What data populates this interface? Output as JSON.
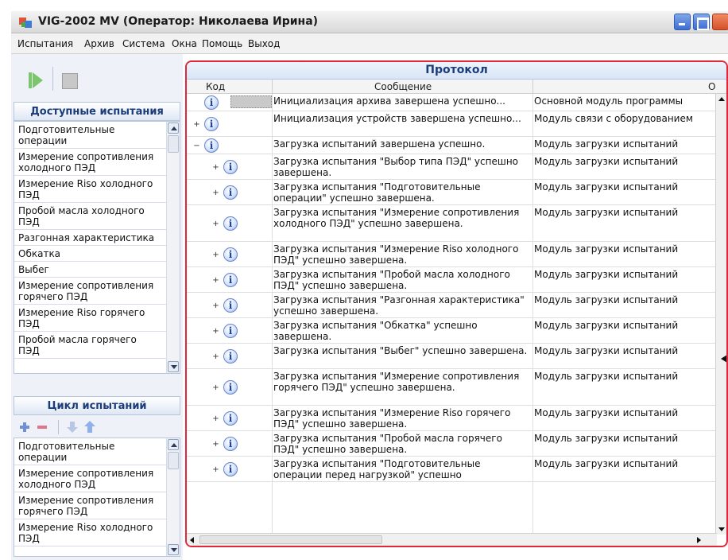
{
  "window": {
    "title": "VIG-2002 MV (Оператор: Николаева Ирина)"
  },
  "menu": [
    "Испытания",
    "Архив",
    "Система",
    "Окна",
    "Помощь",
    "Выход"
  ],
  "available_tests": {
    "title": "Доступные испытания",
    "items": [
      "Подготовительные операции",
      "Измерение сопротивления холодного ПЭД",
      "Измерение Riso холодного ПЭД",
      "Пробой масла холодного ПЭД",
      "Разгонная характеристика",
      "Обкатка",
      "Выбег",
      "Измерение сопротивления горячего ПЭД",
      "Измерение Riso горячего ПЭД",
      "Пробой масла горячего ПЭД"
    ]
  },
  "test_cycle": {
    "title": "Цикл испытаний",
    "items": [
      "Подготовительные операции",
      "Измерение сопротивления холодного ПЭД",
      "Измерение сопротивления горячего ПЭД",
      "Измерение Riso холодного ПЭД"
    ]
  },
  "protocol": {
    "title": "Протокол",
    "columns": {
      "code": "Код",
      "message": "Сообщение",
      "source": "О"
    },
    "info_glyph": "i",
    "rows": [
      {
        "level": 0,
        "expander": "",
        "message": "Инициализация архива завершена успешно...",
        "source": "Основной модуль программы"
      },
      {
        "level": 0,
        "expander": "+",
        "message": "Инициализация устройств завершена успешно...",
        "source": "Модуль связи с оборудованием"
      },
      {
        "level": 0,
        "expander": "−",
        "message": "Загрузка испытаний завершена успешно.",
        "source": "Модуль загрузки испытаний"
      },
      {
        "level": 1,
        "expander": "+",
        "message": "Загрузка испытания \"Выбор типа ПЭД\" успешно завершена.",
        "source": "Модуль загрузки испытаний"
      },
      {
        "level": 1,
        "expander": "+",
        "message": "Загрузка испытания \"Подготовительные операции\" успешно завершена.",
        "source": "Модуль загрузки испытаний"
      },
      {
        "level": 1,
        "expander": "+",
        "message": "Загрузка испытания \"Измерение сопротивления холодного ПЭД\" успешно завершена.",
        "source": "Модуль загрузки испытаний"
      },
      {
        "level": 1,
        "expander": "+",
        "message": "Загрузка испытания \"Измерение Riso холодного ПЭД\" успешно завершена.",
        "source": "Модуль загрузки испытаний"
      },
      {
        "level": 1,
        "expander": "+",
        "message": "Загрузка испытания \"Пробой масла холодного ПЭД\" успешно завершена.",
        "source": "Модуль загрузки испытаний"
      },
      {
        "level": 1,
        "expander": "+",
        "message": "Загрузка испытания \"Разгонная характеристика\" успешно завершена.",
        "source": "Модуль загрузки испытаний"
      },
      {
        "level": 1,
        "expander": "+",
        "message": "Загрузка испытания \"Обкатка\" успешно завершена.",
        "source": "Модуль загрузки испытаний"
      },
      {
        "level": 1,
        "expander": "+",
        "message": "Загрузка испытания \"Выбег\" успешно завершена.",
        "source": "Модуль загрузки испытаний"
      },
      {
        "level": 1,
        "expander": "+",
        "message": "Загрузка испытания \"Измерение сопротивления горячего ПЭД\" успешно завершена.",
        "source": "Модуль загрузки испытаний"
      },
      {
        "level": 1,
        "expander": "+",
        "message": "Загрузка испытания \"Измерение Riso горячего ПЭД\" успешно завершена.",
        "source": "Модуль загрузки испытаний"
      },
      {
        "level": 1,
        "expander": "+",
        "message": "Загрузка испытания \"Пробой масла горячего ПЭД\" успешно завершена.",
        "source": "Модуль загрузки испытаний"
      },
      {
        "level": 1,
        "expander": "+",
        "message": "Загрузка испытания \"Подготовительные операции перед нагрузкой\" успешно",
        "source": "Модуль загрузки испытаний"
      }
    ]
  },
  "colors": {
    "accent": "#1b3c78",
    "highlight_border": "#e0283c"
  }
}
